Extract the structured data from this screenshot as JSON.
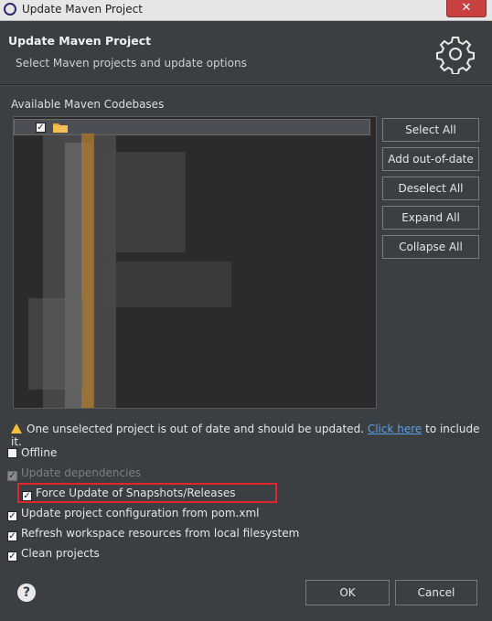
{
  "window": {
    "title": "Update Maven Project",
    "close_label": "✕"
  },
  "header": {
    "title": "Update Maven Project",
    "subtitle": "Select Maven projects and update options",
    "icon": "gear-icon"
  },
  "codebases": {
    "label": "Available Maven Codebases",
    "first_row_checked": "✓"
  },
  "side_buttons": [
    {
      "label": "Select All"
    },
    {
      "label": "Add out-of-date"
    },
    {
      "label": "Deselect All"
    },
    {
      "label": "Expand All"
    },
    {
      "label": "Collapse All"
    }
  ],
  "warning": {
    "text_before": "One unselected project is out of date and should be updated.",
    "link": "Click here",
    "text_after": "to include it."
  },
  "options": [
    {
      "label": "Offline",
      "checked": false,
      "disabled": false
    },
    {
      "label": "Update dependencies",
      "checked": true,
      "disabled": true
    },
    {
      "label": "Force Update of Snapshots/Releases",
      "checked": true,
      "disabled": false
    },
    {
      "label": "Update project configuration from pom.xml",
      "checked": true,
      "disabled": false
    },
    {
      "label": "Refresh workspace resources from local filesystem",
      "checked": true,
      "disabled": false
    },
    {
      "label": "Clean projects",
      "checked": true,
      "disabled": false
    }
  ],
  "footer": {
    "help": "?",
    "ok": "OK",
    "cancel": "Cancel"
  },
  "colors": {
    "highlight": "#e0262c",
    "link": "#5aa0e8",
    "warning": "#f2c037"
  }
}
